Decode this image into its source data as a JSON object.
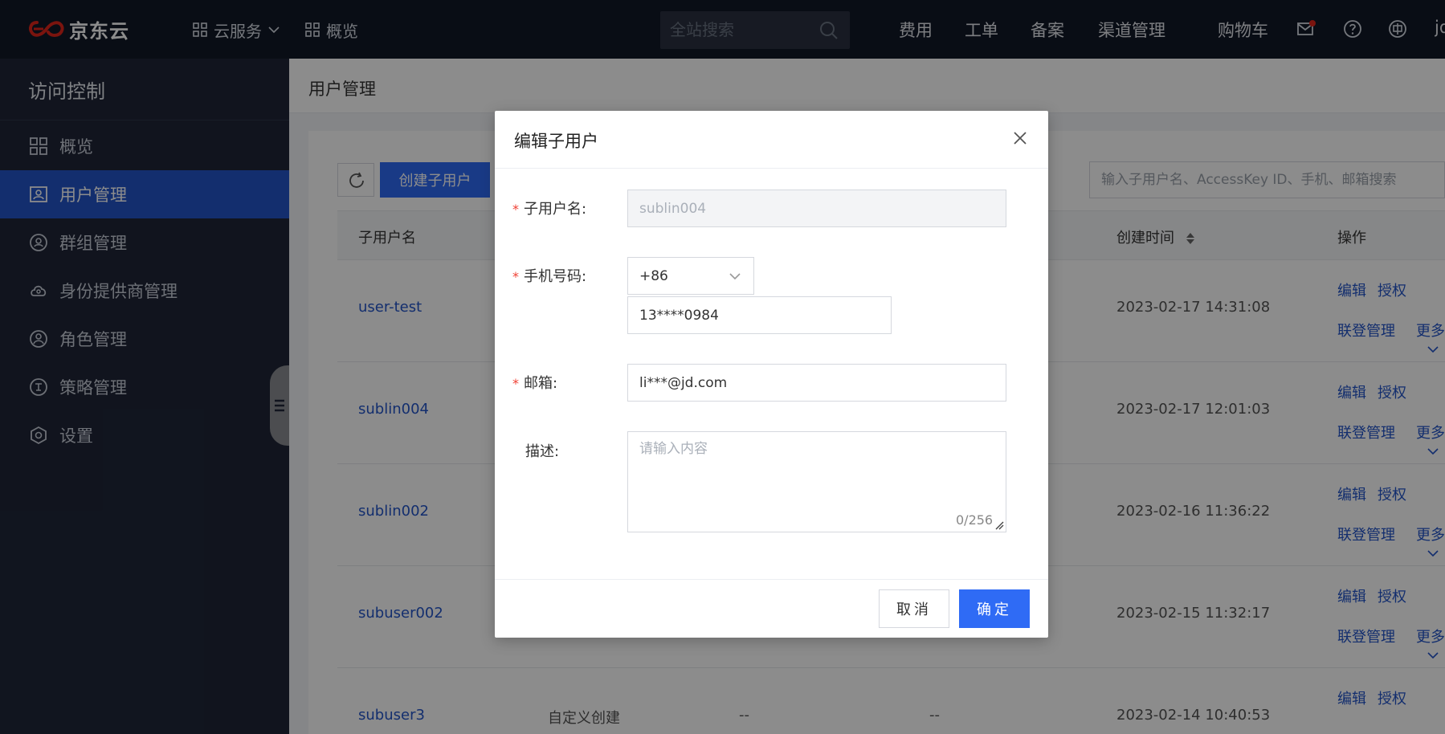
{
  "topbar": {
    "logo_text": "京东云",
    "nav": [
      {
        "label": "云服务"
      },
      {
        "label": "概览"
      }
    ],
    "search_placeholder": "全站搜索",
    "links": [
      "费用",
      "工单",
      "备案",
      "渠道管理",
      "购物车"
    ],
    "user_initial": "jd"
  },
  "sidebar": {
    "title": "访问控制",
    "items": [
      {
        "label": "概览",
        "icon": "overview-icon"
      },
      {
        "label": "用户管理",
        "icon": "user-card-icon"
      },
      {
        "label": "群组管理",
        "icon": "group-icon"
      },
      {
        "label": "身份提供商管理",
        "icon": "identity-provider-icon"
      },
      {
        "label": "角色管理",
        "icon": "role-icon"
      },
      {
        "label": "策略管理",
        "icon": "policy-icon"
      },
      {
        "label": "设置",
        "icon": "settings-icon"
      }
    ]
  },
  "page": {
    "title": "用户管理",
    "create_button": "创建子用户",
    "filter_placeholder": "输入子用户名、AccessKey ID、手机、邮箱搜索"
  },
  "table": {
    "headers": {
      "name": "子用户名",
      "created": "创建时间",
      "ops": "操作"
    },
    "rows": [
      {
        "name": "user-test",
        "created": "2023-02-17 14:31:08"
      },
      {
        "name": "sublin004",
        "created": "2023-02-17 12:01:03"
      },
      {
        "name": "sublin002",
        "created": "2023-02-16 11:36:22"
      },
      {
        "name": "subuser002",
        "created": "2023-02-15 11:32:17"
      },
      {
        "name": "subuser3",
        "source": "自定义创建",
        "phone": "--",
        "email": "--",
        "created": "2023-02-14 10:40:53"
      }
    ],
    "op_labels": {
      "edit": "编辑",
      "auth": "授权",
      "federation": "联登管理",
      "more": "更多"
    }
  },
  "modal": {
    "title": "编辑子用户",
    "username_label": "子用户名:",
    "username_value": "sublin004",
    "phone_label": "手机号码:",
    "country_code": "+86",
    "phone_value": "13****0984",
    "email_label": "邮箱:",
    "email_value": "li***@jd.com",
    "desc_label": "描述:",
    "desc_placeholder": "请输入内容",
    "desc_counter": "0/256",
    "required_mark": "*",
    "cancel": "取消",
    "ok": "确定"
  },
  "colors": {
    "topbar_bg": "#111827",
    "sidebar_bg": "#1f2638",
    "sidebar_active": "#2355c9",
    "primary": "#2f6bf5",
    "link": "#2355c9",
    "required": "#f04134"
  }
}
